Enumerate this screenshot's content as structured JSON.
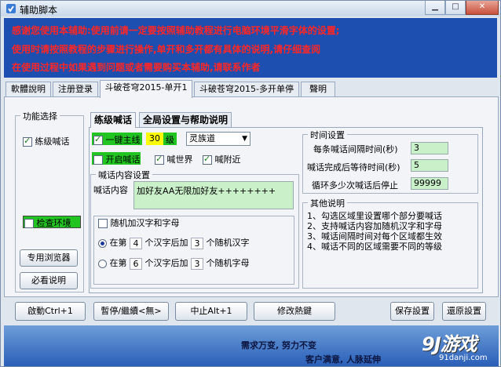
{
  "window": {
    "title": "辅助脚本"
  },
  "notice": {
    "lines": [
      "感谢您使用本辅助:使用前请一定要按照辅助教程进行电脑环境平滑字体的设置;",
      "使用时请按照教程的步骤进行操作,单开和多开都有具体的说明,请仔细查阅",
      "在使用过程中如果遇到问题或者需要购买本辅助,请联系作者"
    ]
  },
  "tabs": [
    "軟體說明",
    "注册登录",
    "斗破苍穹2015-单开1",
    "斗破苍穹2015-多开单停",
    "聲明"
  ],
  "left": {
    "group_label": "功能选择",
    "practice_shout": "练级喊话",
    "check_env": "检查环境",
    "browser_btn": "专用浏览器",
    "must_read_btn": "必看说明"
  },
  "inner_tabs": [
    "练级喊话",
    "全局设置与帮助说明"
  ],
  "shout": {
    "main_line_label": "一键主线",
    "level_value": "30",
    "level_unit": "级",
    "path_select": "灵族道",
    "open_shout": "开启喊话",
    "shout_world": "喊世界",
    "shout_nearby": "喊附近",
    "content_group": "喊话内容设置",
    "content_label": "喊话内容",
    "content_value": "加好友AA无限加好友++++++++",
    "random_label": "随机加汉字和字母",
    "radio1": {
      "pre": "在第",
      "n1": "4",
      "mid": "个汉字后加",
      "n2": "3",
      "post": "个随机汉字"
    },
    "radio2": {
      "pre": "在第",
      "n1": "6",
      "mid": "个汉字后加",
      "n2": "3",
      "post": "个随机字母"
    }
  },
  "timing": {
    "group": "时间设置",
    "interval_label": "每条喊话间隔时间(秒)",
    "interval_value": "3",
    "wait_label": "喊话完成后等待时间(秒)",
    "wait_value": "5",
    "loops_label": "循环多少次喊话后停止",
    "loops_value": "99999"
  },
  "other": {
    "group": "其他说明",
    "lines": [
      "1、勾选区域里设置哪个部分要喊话",
      "2、支持喊话内容加随机汉字和字母",
      "3、喊话间隔时间对每个区域都生效",
      "4、喊话不同的区域需要不同的等级"
    ]
  },
  "bottom_buttons": {
    "start": "啟動Ctrl+1",
    "pause": "暫停/繼續<無>",
    "stop": "中止Alt+1",
    "hotkey": "修改熱鍵",
    "save": "保存設置",
    "restore": "還原設置"
  },
  "footer": {
    "line1": "需求万变, 努力不变",
    "line2": "客户满意, 人脉延伸"
  },
  "watermark": {
    "big": "9J游戏",
    "small": "91danji.com"
  },
  "colors": {
    "notice_bg": "#1d4fb0",
    "notice_text": "#ff2626",
    "field_green": "#c9f0c9",
    "highlight_green": "#22c422",
    "level_yellow": "#ffff00"
  }
}
